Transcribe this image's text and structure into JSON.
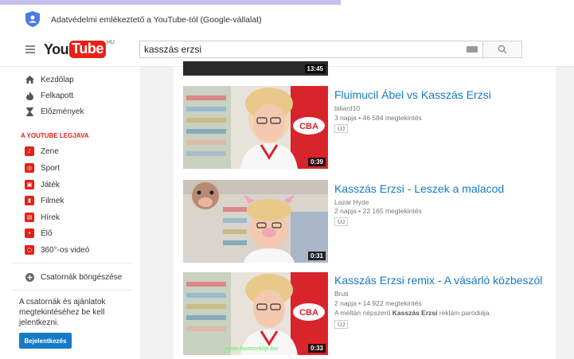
{
  "notice": {
    "text": "Adatvédelmi emlékeztető a YouTube-tól (Google-vállalat)"
  },
  "masthead": {
    "logo_you": "You",
    "logo_tube": "Tube",
    "logo_region": "HU",
    "search_value": "kasszás erzsi"
  },
  "sidebar": {
    "nav": [
      {
        "label": "Kezdőlap",
        "icon": "home-icon"
      },
      {
        "label": "Felkapott",
        "icon": "flame-icon"
      },
      {
        "label": "Előzmények",
        "icon": "hourglass-icon"
      }
    ],
    "section_title": "A YOUTUBE LEGJAVA",
    "categories": [
      {
        "label": "Zene",
        "icon": "music-icon"
      },
      {
        "label": "Sport",
        "icon": "sport-icon"
      },
      {
        "label": "Játék",
        "icon": "gamepad-icon"
      },
      {
        "label": "Filmek",
        "icon": "film-icon"
      },
      {
        "label": "Hírek",
        "icon": "news-icon"
      },
      {
        "label": "Élő",
        "icon": "live-icon"
      },
      {
        "label": "360°-os videó",
        "icon": "360-video-icon"
      }
    ],
    "browse_channels": "Csatornák böngészése",
    "signin_prompt": "A csatornák és ajánlatok megtekintéséhez be kell jelentkezni.",
    "signin_button": "Bejelentkezés"
  },
  "results": {
    "partial_video": {
      "duration": "13:45"
    },
    "videos": [
      {
        "title": "Fluimucil Ábel vs Kasszás Erzsi",
        "channel": "biliard10",
        "meta": "3 napja • 46 584 megtekintés",
        "badge": "ÚJ",
        "duration": "0:39",
        "desc_before": "",
        "desc_bold": "",
        "desc_after": ""
      },
      {
        "title": "Kasszás Erzsi - Leszek a malacod",
        "channel": "Lazar Hyde",
        "meta": "2 napja • 22 165 megtekintés",
        "badge": "ÚJ",
        "duration": "0:31",
        "desc_before": "",
        "desc_bold": "",
        "desc_after": ""
      },
      {
        "title": "Kasszás Erzsi remix - A vásárló közbeszól",
        "channel": "Bruti",
        "meta": "2 napja • 14 922 megtekintés",
        "badge": "ÚJ",
        "duration": "0:33",
        "desc_before": "A méltán népszerű ",
        "desc_bold": "Kasszás Erzsi",
        "desc_after": " reklám paródiája.",
        "watermark": "www.humorklip.hu"
      }
    ]
  },
  "colors": {
    "brand_red": "#e62117",
    "link_blue": "#167ac6",
    "cba_red": "#d8242b"
  }
}
